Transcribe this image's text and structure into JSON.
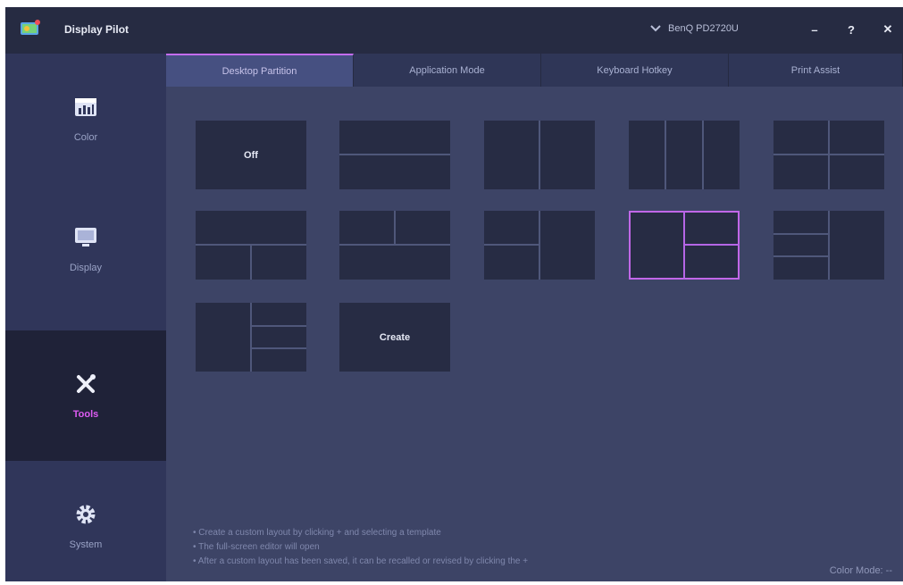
{
  "app": {
    "title": "Display Pilot",
    "monitor": "BenQ PD2720U",
    "window_controls": {
      "minimize": "–",
      "help": "?",
      "close": "✕"
    }
  },
  "sidebar": {
    "items": [
      {
        "label": "Color",
        "icon": "color-chart-icon",
        "active": false
      },
      {
        "label": "Display",
        "icon": "monitor-icon",
        "active": false
      },
      {
        "label": "Tools",
        "icon": "tools-icon",
        "active": true
      },
      {
        "label": "System",
        "icon": "gear-icon",
        "active": false
      }
    ]
  },
  "tabs": [
    {
      "label": "Desktop Partition",
      "active": true
    },
    {
      "label": "Application Mode",
      "active": false
    },
    {
      "label": "Keyboard Hotkey",
      "active": false
    },
    {
      "label": "Print Assist",
      "active": false
    }
  ],
  "partition": {
    "off_label": "Off",
    "create_label": "Create",
    "selected_layout": 9
  },
  "hints": [
    "• Create a custom layout by clicking + and selecting a template",
    "• The full-screen editor will open",
    "• After a custom layout has been saved, it can be recalled or revised by clicking the +"
  ],
  "status": {
    "color_mode": "Color Mode: --"
  },
  "colors": {
    "accent": "#c46df0",
    "sidebar": "#30365a",
    "content": "#3d4466",
    "titlebar": "#262b42"
  }
}
